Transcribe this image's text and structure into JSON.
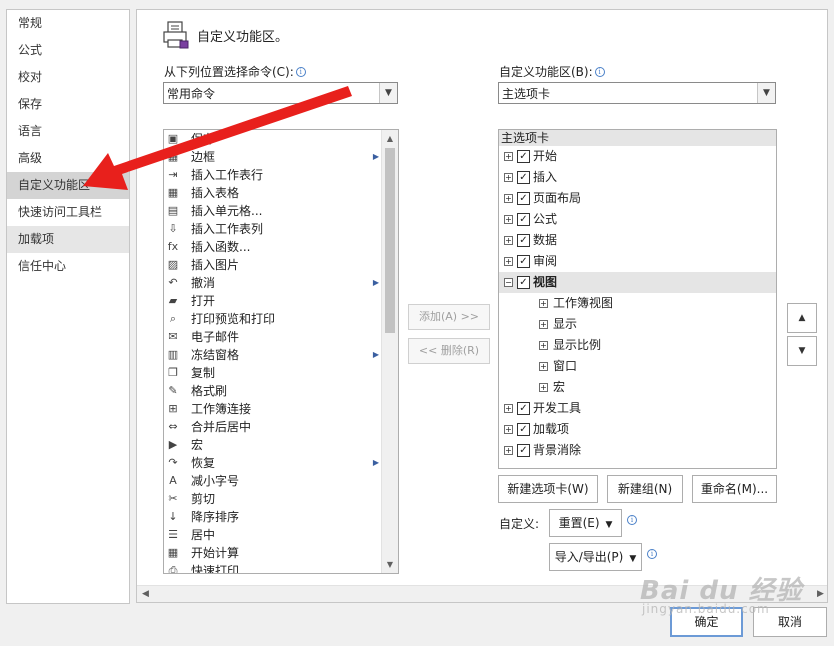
{
  "nav": {
    "items": [
      {
        "label": "常规"
      },
      {
        "label": "公式"
      },
      {
        "label": "校对"
      },
      {
        "label": "保存"
      },
      {
        "label": "语言"
      },
      {
        "label": "高级"
      },
      {
        "label": "自定义功能区",
        "selected": true
      },
      {
        "label": "快速访问工具栏"
      },
      {
        "label": "加载项",
        "shaded": true
      },
      {
        "label": "信任中心"
      }
    ]
  },
  "main": {
    "title": "自定义功能区。",
    "left_label": "从下列位置选择命令(C):",
    "left_combo_value": "常用命令",
    "right_label": "自定义功能区(B):",
    "right_combo_value": "主选项卡",
    "commands": [
      {
        "label": "保存",
        "icon": "save-icon",
        "glyph": "▣",
        "submenu": false
      },
      {
        "label": "边框",
        "icon": "border-icon",
        "glyph": "▦",
        "submenu": true
      },
      {
        "label": "插入工作表行",
        "icon": "insert-row-icon",
        "glyph": "⇥",
        "submenu": false
      },
      {
        "label": "插入表格",
        "icon": "table-icon",
        "glyph": "▦",
        "submenu": false
      },
      {
        "label": "插入单元格...",
        "icon": "insert-cell-icon",
        "glyph": "▤",
        "submenu": false
      },
      {
        "label": "插入工作表列",
        "icon": "insert-column-icon",
        "glyph": "⇩",
        "submenu": false
      },
      {
        "label": "插入函数...",
        "icon": "function-icon",
        "glyph": "fx",
        "submenu": false
      },
      {
        "label": "插入图片",
        "icon": "picture-icon",
        "glyph": "▨",
        "submenu": false
      },
      {
        "label": "撤消",
        "icon": "undo-icon",
        "glyph": "↶",
        "submenu": true
      },
      {
        "label": "打开",
        "icon": "folder-open-icon",
        "glyph": "▰",
        "submenu": false
      },
      {
        "label": "打印预览和打印",
        "icon": "print-preview-icon",
        "glyph": "⌕",
        "submenu": false
      },
      {
        "label": "电子邮件",
        "icon": "email-icon",
        "glyph": "✉",
        "submenu": false
      },
      {
        "label": "冻结窗格",
        "icon": "freeze-panes-icon",
        "glyph": "▥",
        "submenu": true
      },
      {
        "label": "复制",
        "icon": "copy-icon",
        "glyph": "❐",
        "submenu": false
      },
      {
        "label": "格式刷",
        "icon": "format-painter-icon",
        "glyph": "✎",
        "submenu": false
      },
      {
        "label": "工作簿连接",
        "icon": "connection-icon",
        "glyph": "⊞",
        "submenu": false
      },
      {
        "label": "合并后居中",
        "icon": "merge-center-icon",
        "glyph": "⇔",
        "submenu": false
      },
      {
        "label": "宏",
        "icon": "macro-icon",
        "glyph": "▶",
        "submenu": false
      },
      {
        "label": "恢复",
        "icon": "redo-icon",
        "glyph": "↷",
        "submenu": true
      },
      {
        "label": "减小字号",
        "icon": "decrease-font-icon",
        "glyph": "A",
        "submenu": false
      },
      {
        "label": "剪切",
        "icon": "cut-icon",
        "glyph": "✂",
        "submenu": false
      },
      {
        "label": "降序排序",
        "icon": "sort-descending-icon",
        "glyph": "↓",
        "submenu": false
      },
      {
        "label": "居中",
        "icon": "align-center-icon",
        "glyph": "☰",
        "submenu": false
      },
      {
        "label": "开始计算",
        "icon": "calculator-icon",
        "glyph": "▦",
        "submenu": false
      },
      {
        "label": "快速打印",
        "icon": "quick-print-icon",
        "glyph": "⎙",
        "submenu": false
      }
    ],
    "add_button": "添加(A) >>",
    "remove_button": "<< 删除(R)",
    "tree_header": "主选项卡",
    "tabs": [
      {
        "label": "开始",
        "level": 0,
        "expander": "+",
        "checked": true
      },
      {
        "label": "插入",
        "level": 0,
        "expander": "+",
        "checked": true
      },
      {
        "label": "页面布局",
        "level": 0,
        "expander": "+",
        "checked": true
      },
      {
        "label": "公式",
        "level": 0,
        "expander": "+",
        "checked": true
      },
      {
        "label": "数据",
        "level": 0,
        "expander": "+",
        "checked": true
      },
      {
        "label": "审阅",
        "level": 0,
        "expander": "+",
        "checked": true
      },
      {
        "label": "视图",
        "level": 0,
        "expander": "−",
        "checked": true,
        "selected": true
      },
      {
        "label": "工作簿视图",
        "level": 1,
        "expander": "+"
      },
      {
        "label": "显示",
        "level": 1,
        "expander": "+"
      },
      {
        "label": "显示比例",
        "level": 1,
        "expander": "+"
      },
      {
        "label": "窗口",
        "level": 1,
        "expander": "+"
      },
      {
        "label": "宏",
        "level": 1,
        "expander": "+"
      },
      {
        "label": "开发工具",
        "level": 0,
        "expander": "+",
        "checked": true
      },
      {
        "label": "加载项",
        "level": 0,
        "expander": "+",
        "checked": true
      },
      {
        "label": "背景消除",
        "level": 0,
        "expander": "+",
        "checked": true
      }
    ],
    "new_tab_button": "新建选项卡(W)",
    "new_group_button": "新建组(N)",
    "rename_button": "重命名(M)...",
    "customize_label": "自定义:",
    "reset_button": "重置(E)",
    "import_export_button": "导入/导出(P)"
  },
  "footer": {
    "ok_button": "确定",
    "cancel_button": "取消"
  },
  "watermark": {
    "line1": "Bai du 经验",
    "line2": "jingyan.baidu.com"
  },
  "colors": {
    "annotation_arrow": "#e8201c",
    "focus_border": "#6c9ad6",
    "selected_nav": "#d4d4d4"
  }
}
